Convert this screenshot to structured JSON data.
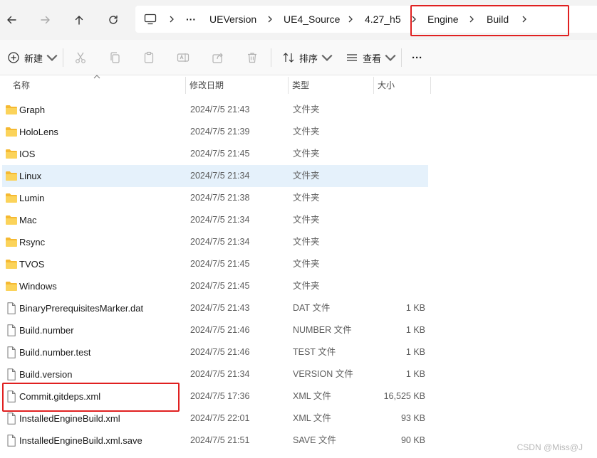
{
  "nav": {
    "back_icon": "arrow-left-icon",
    "forward_icon": "arrow-right-icon",
    "up_icon": "arrow-up-icon",
    "refresh_icon": "refresh-icon"
  },
  "breadcrumb": {
    "root_icon": "monitor-icon",
    "overflow": "···",
    "items": [
      "UEVersion",
      "UE4_Source",
      "4.27_h5",
      "Engine",
      "Build"
    ]
  },
  "toolbar": {
    "new_label": "新建",
    "sort_label": "排序",
    "view_label": "查看",
    "more_label": "···"
  },
  "columns": {
    "name": "名称",
    "date": "修改日期",
    "type": "类型",
    "size": "大小"
  },
  "rows": [
    {
      "name": "Graph",
      "date": "2024/7/5 21:43",
      "type": "文件夹",
      "size": "",
      "kind": "folder"
    },
    {
      "name": "HoloLens",
      "date": "2024/7/5 21:39",
      "type": "文件夹",
      "size": "",
      "kind": "folder"
    },
    {
      "name": "IOS",
      "date": "2024/7/5 21:45",
      "type": "文件夹",
      "size": "",
      "kind": "folder"
    },
    {
      "name": "Linux",
      "date": "2024/7/5 21:34",
      "type": "文件夹",
      "size": "",
      "kind": "folder"
    },
    {
      "name": "Lumin",
      "date": "2024/7/5 21:38",
      "type": "文件夹",
      "size": "",
      "kind": "folder"
    },
    {
      "name": "Mac",
      "date": "2024/7/5 21:34",
      "type": "文件夹",
      "size": "",
      "kind": "folder"
    },
    {
      "name": "Rsync",
      "date": "2024/7/5 21:34",
      "type": "文件夹",
      "size": "",
      "kind": "folder"
    },
    {
      "name": "TVOS",
      "date": "2024/7/5 21:45",
      "type": "文件夹",
      "size": "",
      "kind": "folder"
    },
    {
      "name": "Windows",
      "date": "2024/7/5 21:45",
      "type": "文件夹",
      "size": "",
      "kind": "folder"
    },
    {
      "name": "BinaryPrerequisitesMarker.dat",
      "date": "2024/7/5 21:43",
      "type": "DAT 文件",
      "size": "1 KB",
      "kind": "file"
    },
    {
      "name": "Build.number",
      "date": "2024/7/5 21:46",
      "type": "NUMBER 文件",
      "size": "1 KB",
      "kind": "file"
    },
    {
      "name": "Build.number.test",
      "date": "2024/7/5 21:46",
      "type": "TEST 文件",
      "size": "1 KB",
      "kind": "file"
    },
    {
      "name": "Build.version",
      "date": "2024/7/5 21:34",
      "type": "VERSION 文件",
      "size": "1 KB",
      "kind": "file"
    },
    {
      "name": "Commit.gitdeps.xml",
      "date": "2024/7/5 17:36",
      "type": "XML 文件",
      "size": "16,525 KB",
      "kind": "file"
    },
    {
      "name": "InstalledEngineBuild.xml",
      "date": "2024/7/5 22:01",
      "type": "XML 文件",
      "size": "93 KB",
      "kind": "file"
    },
    {
      "name": "InstalledEngineBuild.xml.save",
      "date": "2024/7/5 21:51",
      "type": "SAVE 文件",
      "size": "90 KB",
      "kind": "file"
    }
  ],
  "selected_row": "Linux",
  "watermark": "CSDN @Miss@J",
  "colors": {
    "highlight_box": "#e02020",
    "selection": "#e5f1fb",
    "folder": "#f8c94a"
  }
}
